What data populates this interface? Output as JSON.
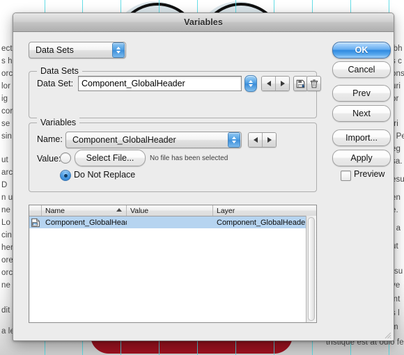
{
  "window": {
    "title": "Variables"
  },
  "kind_popup": {
    "selected": "Data Sets",
    "icon": "stepper-up-down-icon"
  },
  "data_sets_group": {
    "legend": "Data Sets",
    "field_label": "Data Set:",
    "value": "Component_GlobalHeader",
    "stepper_icon": "stepper-up-down-icon",
    "prev_icon": "triangle-left-icon",
    "next_icon": "triangle-right-icon",
    "save_icon": "save-disk-icon",
    "delete_icon": "trash-icon"
  },
  "variables_group": {
    "legend": "Variables",
    "name_label": "Name:",
    "name_value": "Component_GlobalHeader",
    "name_stepper_icon": "stepper-up-down-icon",
    "prev_icon": "triangle-left-icon",
    "next_icon": "triangle-right-icon",
    "value_label": "Value:",
    "select_file_button": "Select File...",
    "file_status": "No file has been selected",
    "select_file_radio_selected": false,
    "do_not_replace_label": "Do Not Replace",
    "do_not_replace_selected": true
  },
  "list": {
    "columns": [
      "Name",
      "Value",
      "Layer"
    ],
    "sorted_column": "Name",
    "sort_direction": "ascending",
    "rows": [
      {
        "icon": "image-document-icon",
        "name": "Component_GlobalHeader",
        "value": "",
        "layer": "Component_GlobalHeader",
        "selected": true
      }
    ]
  },
  "buttons": {
    "ok": "OK",
    "cancel": "Cancel",
    "prev": "Prev",
    "next": "Next",
    "import": "Import...",
    "apply": "Apply",
    "preview_label": "Preview",
    "preview_checked": false
  },
  "colors": {
    "accent_blue": "#2f8ae0",
    "selection_blue": "#b6d4f0",
    "dialog_gray": "#ececec",
    "guide_cyan": "#4ad9e4",
    "artwork_red": "#9e1220"
  },
  "background_text": {
    "left": [
      "ect",
      "s h",
      "orc",
      "lor",
      "ig",
      "cor",
      "se",
      "sin",
      "ut",
      "arc",
      "D",
      "n u",
      "ne",
      "Lo",
      "cin",
      "her",
      "ore",
      "orc",
      "ne",
      "dit",
      "a lectus."
    ],
    "right": [
      "ibh",
      "s c",
      "ons",
      "uri",
      "or",
      "tri",
      ". Pe",
      "eg",
      "sa.",
      "esu",
      "en",
      "e.",
      ", a",
      "ut",
      "rsu",
      "ve",
      "int",
      "s l",
      "m",
      "tristique est at odio feug"
    ]
  },
  "resize_grip": "resize-grip-icon"
}
